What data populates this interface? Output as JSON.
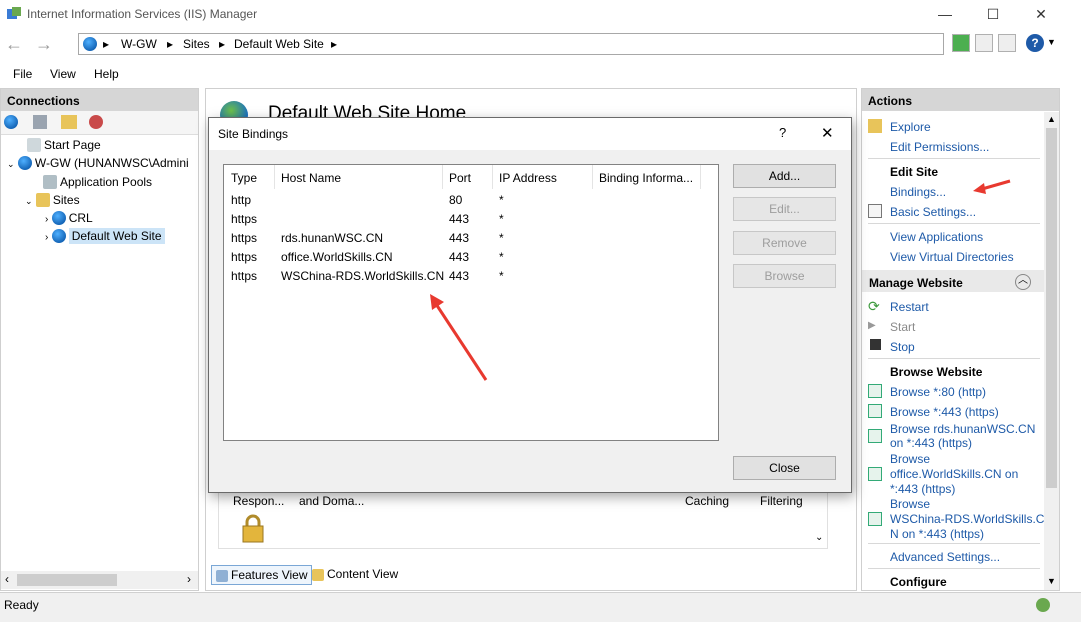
{
  "window": {
    "title": "Internet Information Services (IIS) Manager",
    "min": "—",
    "max": "☐",
    "close": "✕"
  },
  "address": {
    "crumbs": [
      "W-GW",
      "Sites",
      "Default Web Site"
    ]
  },
  "menu": [
    "File",
    "View",
    "Help"
  ],
  "connections": {
    "header": "Connections",
    "tree": {
      "start_page": "Start Page",
      "server": "W-GW (HUNANWSC\\Admini",
      "app_pools": "Application Pools",
      "sites": "Sites",
      "crl": "CRL",
      "default_site": "Default Web Site"
    }
  },
  "center": {
    "heading": "Default Web Site Home",
    "features": [
      "Respon...",
      "and Doma...",
      "Caching",
      "Filtering"
    ],
    "tabs": {
      "features": "Features View",
      "content": "Content View"
    }
  },
  "dialog": {
    "title": "Site Bindings",
    "help": "?",
    "close": "✕",
    "columns": [
      "Type",
      "Host Name",
      "Port",
      "IP Address",
      "Binding Informa..."
    ],
    "rows": [
      {
        "type": "http",
        "host": "",
        "port": "80",
        "ip": "*"
      },
      {
        "type": "https",
        "host": "",
        "port": "443",
        "ip": "*"
      },
      {
        "type": "https",
        "host": "rds.hunanWSC.CN",
        "port": "443",
        "ip": "*"
      },
      {
        "type": "https",
        "host": "office.WorldSkills.CN",
        "port": "443",
        "ip": "*"
      },
      {
        "type": "https",
        "host": "WSChina-RDS.WorldSkills.CN",
        "port": "443",
        "ip": "*"
      }
    ],
    "buttons": {
      "add": "Add...",
      "edit": "Edit...",
      "remove": "Remove",
      "browse": "Browse",
      "close": "Close"
    }
  },
  "actions": {
    "header": "Actions",
    "explore": "Explore",
    "edit_permissions": "Edit Permissions...",
    "edit_site": "Edit Site",
    "bindings": "Bindings...",
    "basic_settings": "Basic Settings...",
    "view_apps": "View Applications",
    "view_vdirs": "View Virtual Directories",
    "manage_website": "Manage Website",
    "restart": "Restart",
    "start": "Start",
    "stop": "Stop",
    "browse_website": "Browse Website",
    "browse_80": "Browse *:80 (http)",
    "browse_443": "Browse *:443 (https)",
    "browse_rds_1": "Browse rds.hunanWSC.CN",
    "browse_rds_2": "on *:443 (https)",
    "browse_office_1": "Browse",
    "browse_office_2": "office.WorldSkills.CN on",
    "browse_office_3": "*:443 (https)",
    "browse_wsc_1": "Browse",
    "browse_wsc_2": "WSChina-RDS.WorldSkills.C",
    "browse_wsc_3": "N on *:443 (https)",
    "advanced_settings": "Advanced Settings...",
    "configure": "Configure"
  },
  "status": {
    "text": "Ready"
  },
  "colors": {
    "link": "#1e5aa8",
    "annotation": "#e8392f"
  }
}
